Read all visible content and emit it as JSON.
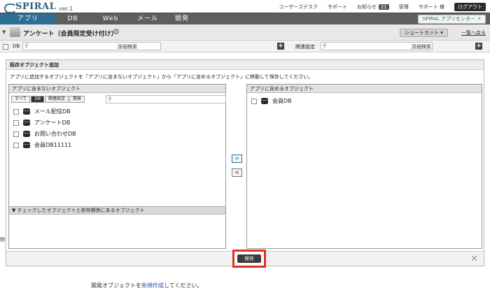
{
  "header": {
    "logo": "SPIRAL",
    "version": "ver.1",
    "links": [
      "ユーザーズデスク",
      "サポート",
      "お知らせ",
      "管理",
      "サポート 様"
    ],
    "notice_count": "21",
    "logout": "ログアウト"
  },
  "nav": {
    "tabs": [
      "アプリ",
      "DB",
      "Web",
      "メール",
      "開発"
    ],
    "active": "アプリ",
    "app_center": "SPIRAL アプリセンター"
  },
  "page": {
    "title": "アンケート（会員限定受け付け）",
    "shortcut": "ショートカット",
    "back_link": "一覧へ戻る"
  },
  "search": {
    "db_label": "DB",
    "advanced": "詳細検索",
    "related_label": "関連設定",
    "related_advanced": "詳細検索"
  },
  "panel": {
    "title": "既存オブジェクト追加",
    "description": "アプリに追加するオブジェクトを「アプリに含まないオブジェクト」から「アプリに含めるオブジェクト」に移動して保存してください。",
    "left": {
      "title": "アプリに含まないオブジェクト",
      "filters": [
        "すべて",
        "DB",
        "関連設定",
        "開発"
      ],
      "active_filter": "DB",
      "items": [
        "メール配信DB",
        "アンケートDB",
        "お問い合わせDB",
        "会員DB11111"
      ],
      "dependency_title": "▼ チェックしたオブジェクトと依存関係にあるオブジェクト"
    },
    "right": {
      "title": "アプリに含めるオブジェクト",
      "items": [
        "会員DB"
      ]
    },
    "move_right": ">",
    "move_left": "<",
    "save": "保存",
    "close": "✕"
  },
  "background": {
    "side_char": "関",
    "bottom_prefix": "開発オブジェクトを",
    "bottom_link": "新規作成",
    "bottom_suffix": "してください。"
  },
  "colors": {
    "active_tab": "#2c6e94",
    "nav": "#5e5e5e",
    "highlight": "#e03020"
  }
}
